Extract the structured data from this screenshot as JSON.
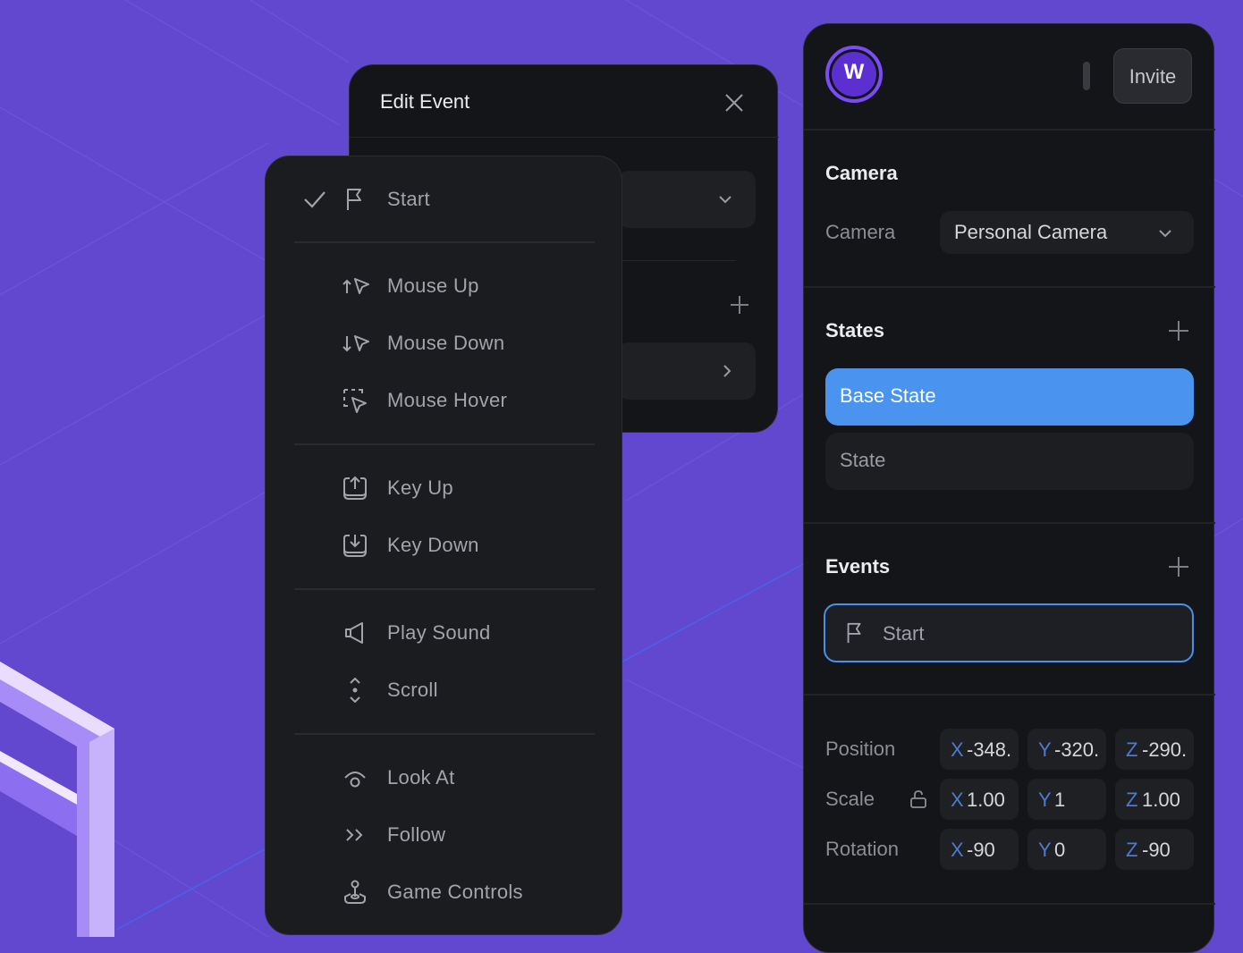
{
  "edit_event": {
    "title": "Edit Event"
  },
  "event_menu": {
    "items": [
      {
        "label": "Start",
        "icon": "flag-icon",
        "selected": true
      },
      {
        "label": "Mouse Up",
        "icon": "mouse-up-icon"
      },
      {
        "label": "Mouse Down",
        "icon": "mouse-down-icon"
      },
      {
        "label": "Mouse Hover",
        "icon": "mouse-hover-icon"
      },
      {
        "label": "Key Up",
        "icon": "key-up-icon"
      },
      {
        "label": "Key Down",
        "icon": "key-down-icon"
      },
      {
        "label": "Play Sound",
        "icon": "speaker-icon"
      },
      {
        "label": "Scroll",
        "icon": "scroll-icon"
      },
      {
        "label": "Look At",
        "icon": "look-at-icon"
      },
      {
        "label": "Follow",
        "icon": "follow-icon"
      },
      {
        "label": "Game Controls",
        "icon": "joystick-icon"
      }
    ]
  },
  "inspector": {
    "avatar_initial": "W",
    "invite_label": "Invite",
    "camera": {
      "section_title": "Camera",
      "field_label": "Camera",
      "selected_value": "Personal Camera"
    },
    "states": {
      "section_title": "States",
      "items": [
        "Base State",
        "State"
      ]
    },
    "events": {
      "section_title": "Events",
      "items": [
        "Start"
      ]
    },
    "transform": {
      "position_label": "Position",
      "scale_label": "Scale",
      "rotation_label": "Rotation",
      "position": {
        "x": "-348.",
        "y": "-320.",
        "z": "-290."
      },
      "scale": {
        "x": "1.00",
        "y": "1",
        "z": "1.00"
      },
      "rotation": {
        "x": "-90",
        "y": "0",
        "z": "-90"
      },
      "axis_labels": {
        "x": "X",
        "y": "Y",
        "z": "Z"
      }
    }
  },
  "colors": {
    "background": "#6148cf",
    "panel": "#141518",
    "accent_blue": "#4a94f0",
    "avatar": "#7a4cf3"
  }
}
